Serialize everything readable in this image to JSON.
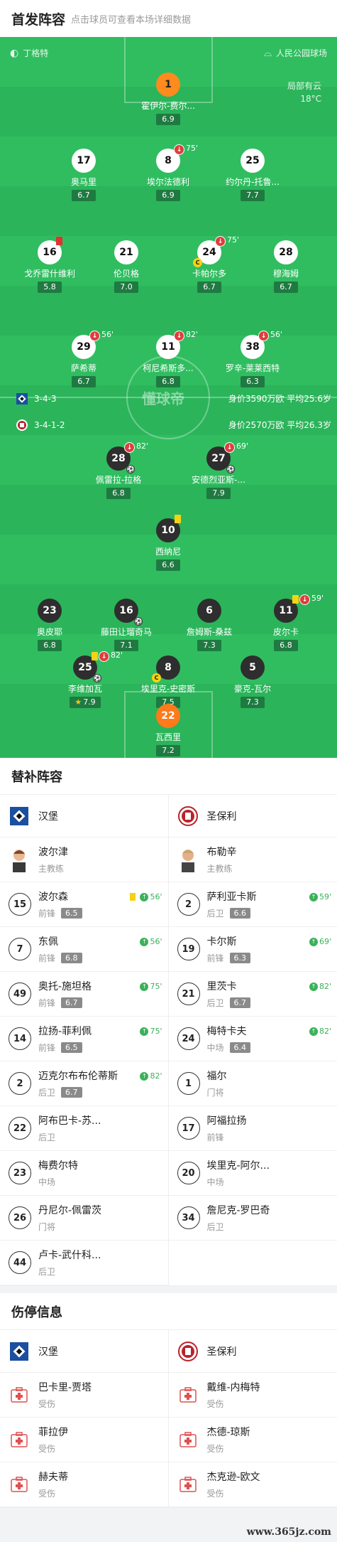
{
  "header": {
    "title": "首发阵容",
    "subtitle": "点击球员可查看本场详细数据"
  },
  "pitch": {
    "referee": "丁格特",
    "stadium": "人民公园球场",
    "weather": "局部有云",
    "temp": "18°C",
    "watermark": "懂球帝",
    "home": {
      "formation": "3-4-3",
      "value": "身价3590万欧 平均25.6岁"
    },
    "away": {
      "formation": "3-4-1-2",
      "value": "身价2570万欧 平均26.3岁"
    },
    "home_players": [
      {
        "num": "1",
        "name": "霍伊尔-费尔...",
        "rating": "6.9"
      },
      {
        "num": "17",
        "name": "奥马里",
        "rating": "6.7"
      },
      {
        "num": "8",
        "name": "埃尔法德利",
        "rating": "6.9",
        "sub": "75'"
      },
      {
        "num": "25",
        "name": "约尔丹-托鲁...",
        "rating": "7.7"
      },
      {
        "num": "16",
        "name": "戈乔雷什维利",
        "rating": "5.8"
      },
      {
        "num": "21",
        "name": "伦贝格",
        "rating": "7.0"
      },
      {
        "num": "24",
        "name": "卡帕尔多",
        "rating": "6.7",
        "sub": "75'"
      },
      {
        "num": "28",
        "name": "穆海姆",
        "rating": "6.7"
      },
      {
        "num": "29",
        "name": "萨希蒂",
        "rating": "6.7",
        "sub": "56'"
      },
      {
        "num": "11",
        "name": "柯尼希斯多...",
        "rating": "6.8",
        "sub": "82'"
      },
      {
        "num": "38",
        "name": "罗辛-莱莱西特",
        "rating": "6.3",
        "sub": "56'"
      }
    ],
    "away_players": [
      {
        "num": "28",
        "name": "佩雷拉-拉格",
        "rating": "6.8",
        "sub": "82'"
      },
      {
        "num": "27",
        "name": "安德烈亚斯-...",
        "rating": "7.9",
        "sub": "69'"
      },
      {
        "num": "10",
        "name": "西纳尼",
        "rating": "6.6"
      },
      {
        "num": "23",
        "name": "奥皮耶",
        "rating": "6.8"
      },
      {
        "num": "16",
        "name": "藤田让瑠奇马",
        "rating": "7.1"
      },
      {
        "num": "6",
        "name": "詹姆斯-桑兹",
        "rating": "7.3"
      },
      {
        "num": "11",
        "name": "皮尔卡",
        "rating": "6.8",
        "sub": "59'"
      },
      {
        "num": "25",
        "name": "李维加瓦",
        "rating": "7.9",
        "sub": "82'"
      },
      {
        "num": "8",
        "name": "埃里克-史密斯",
        "rating": "7.5"
      },
      {
        "num": "5",
        "name": "豪克-瓦尔",
        "rating": "7.3"
      },
      {
        "num": "22",
        "name": "瓦西里",
        "rating": "7.2"
      }
    ]
  },
  "subs": {
    "title": "替补阵容",
    "home": {
      "team": "汉堡",
      "coach": {
        "name": "波尔津",
        "role": "主教练"
      },
      "players": [
        {
          "num": "15",
          "name": "波尔森",
          "pos": "前锋",
          "rating": "6.5",
          "min": "56'"
        },
        {
          "num": "7",
          "name": "东佩",
          "pos": "前锋",
          "rating": "6.8",
          "min": "56'"
        },
        {
          "num": "49",
          "name": "奥托-施坦格",
          "pos": "前锋",
          "rating": "6.7",
          "min": "75'"
        },
        {
          "num": "14",
          "name": "拉扬-菲利佩",
          "pos": "前锋",
          "rating": "6.5",
          "min": "75'"
        },
        {
          "num": "2",
          "name": "迈克尔布布伦蒂斯",
          "pos": "后卫",
          "rating": "6.7",
          "min": "82'"
        },
        {
          "num": "22",
          "name": "阿布巴卡-苏...",
          "pos": "后卫"
        },
        {
          "num": "23",
          "name": "梅费尔特",
          "pos": "中场"
        },
        {
          "num": "26",
          "name": "丹尼尔-佩雷茨",
          "pos": "门将"
        },
        {
          "num": "44",
          "name": "卢卡-武什科...",
          "pos": "后卫"
        }
      ]
    },
    "away": {
      "team": "圣保利",
      "coach": {
        "name": "布勒辛",
        "role": "主教练"
      },
      "players": [
        {
          "num": "2",
          "name": "萨利亚卡斯",
          "pos": "后卫",
          "rating": "6.6",
          "min": "59'"
        },
        {
          "num": "19",
          "name": "卡尔斯",
          "pos": "前锋",
          "rating": "6.3",
          "min": "69'"
        },
        {
          "num": "21",
          "name": "里茨卡",
          "pos": "后卫",
          "rating": "6.7",
          "min": "82'"
        },
        {
          "num": "24",
          "name": "梅特卡夫",
          "pos": "中场",
          "rating": "6.4",
          "min": "82'"
        },
        {
          "num": "1",
          "name": "福尔",
          "pos": "门将"
        },
        {
          "num": "17",
          "name": "阿福拉扬",
          "pos": "前锋"
        },
        {
          "num": "20",
          "name": "埃里克-阿尔...",
          "pos": "中场"
        },
        {
          "num": "34",
          "name": "詹尼克-罗巴奇",
          "pos": "后卫"
        }
      ]
    }
  },
  "injuries": {
    "title": "伤停信息",
    "home": {
      "team": "汉堡",
      "players": [
        {
          "name": "巴卡里-贾塔",
          "status": "受伤"
        },
        {
          "name": "菲拉伊",
          "status": "受伤"
        },
        {
          "name": "赫夫蒂",
          "status": "受伤"
        }
      ]
    },
    "away": {
      "team": "圣保利",
      "players": [
        {
          "name": "戴维-内梅特",
          "status": "受伤"
        },
        {
          "name": "杰德-琼斯",
          "status": "受伤"
        },
        {
          "name": "杰克逊-欧文",
          "status": "受伤"
        }
      ]
    }
  },
  "watermark": "www.365jz.com"
}
